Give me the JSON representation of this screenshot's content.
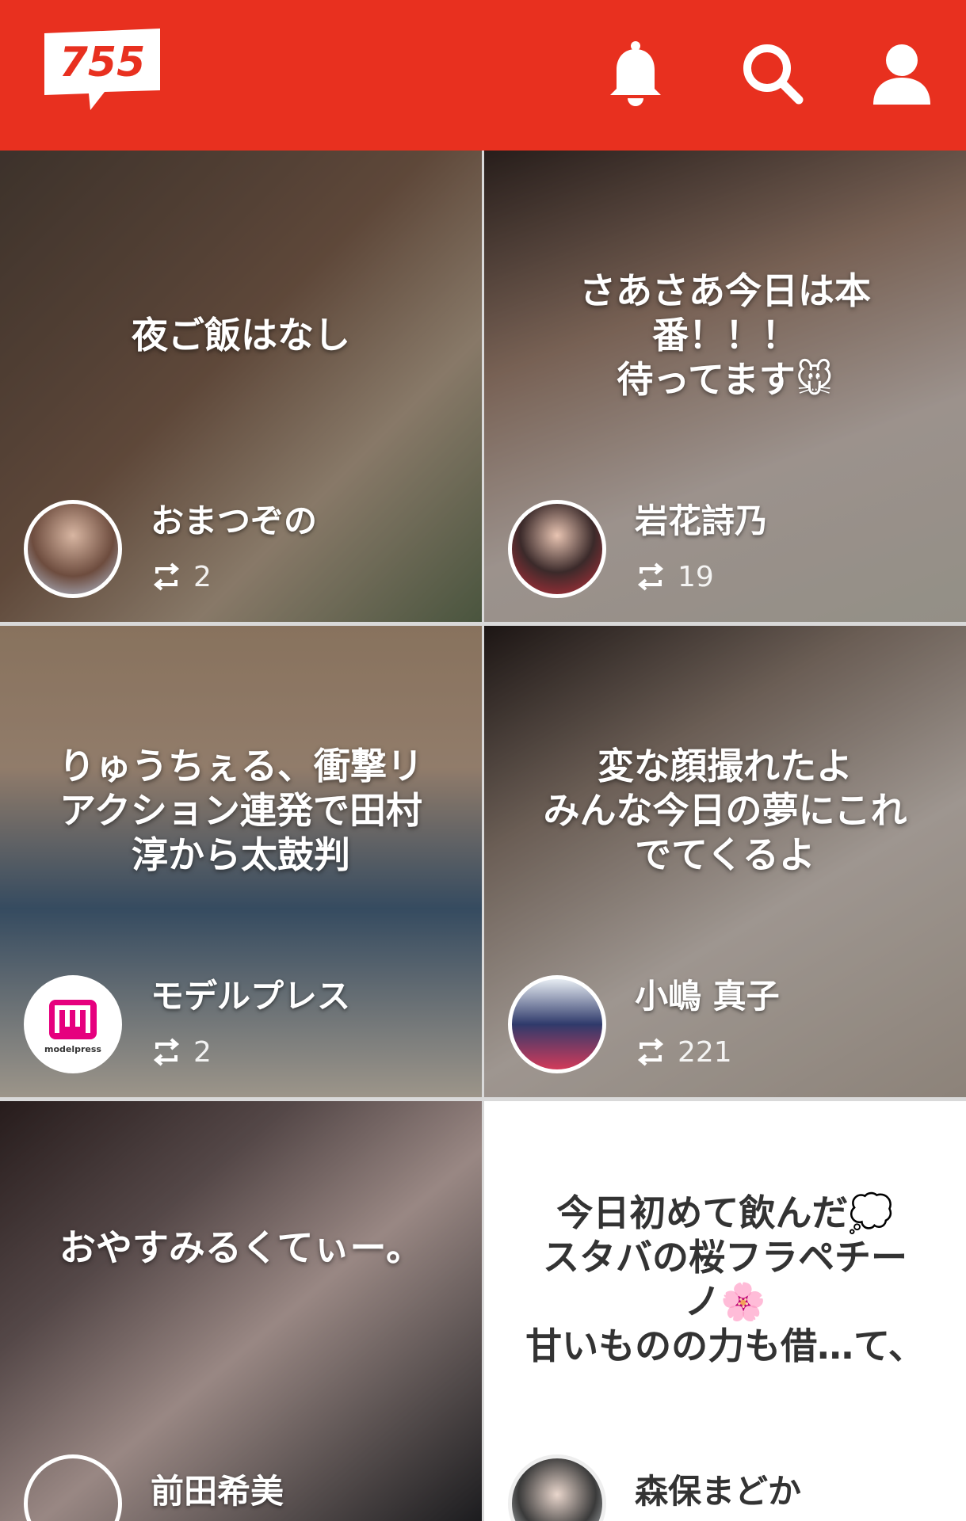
{
  "app": {
    "logo_text": "755",
    "brand_color": "#e8301f"
  },
  "header": {
    "icons": [
      "bell-icon",
      "search-icon",
      "user-icon"
    ]
  },
  "feed": [
    {
      "caption": "夜ご飯はなし",
      "user": "おまつぞの",
      "repost_count": "2",
      "style": "photo",
      "tone": "#8b6a55"
    },
    {
      "caption": "さあさあ今日は本\n番！！！\n待ってます🐭",
      "user": "岩花詩乃",
      "repost_count": "19",
      "style": "photo",
      "tone": "#b08f7c"
    },
    {
      "caption": "りゅうちぇる、衝撃リ\nアクション連発で田村\n淳から太鼓判",
      "user": "モデルプレス",
      "avatar_text": "modelpress",
      "repost_count": "2",
      "style": "photo",
      "tone": "#4f6f8e"
    },
    {
      "caption": "変な顔撮れたよ\nみんな今日の夢にこれ\nでてくるよ",
      "user": "小嶋 真子",
      "repost_count": "221",
      "style": "photo",
      "tone": "#9d8a7d"
    },
    {
      "caption": "おやすみるくてぃー。",
      "user": "前田希美",
      "repost_count": "",
      "style": "photo",
      "tone": "#7d6a6a"
    },
    {
      "caption": "今日初めて飲んだ💭\nスタバの桜フラペチー\nノ🌸\n甘いものの力も借…て、",
      "user": "森保まどか",
      "repost_count": "",
      "style": "light",
      "tone": "#ffffff"
    }
  ]
}
